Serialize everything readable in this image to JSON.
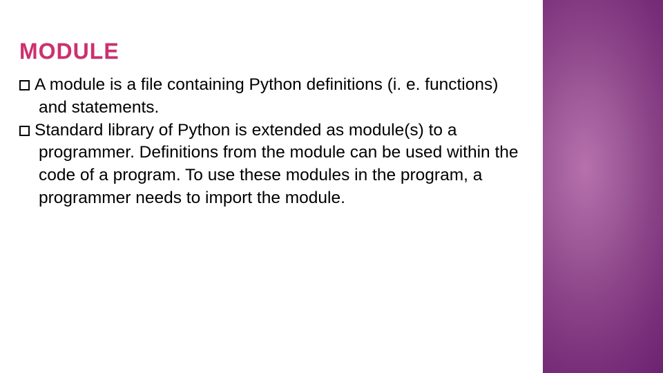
{
  "slide": {
    "title": "MODULE",
    "bullets": [
      "A module is a file containing Python definitions (i. e. functions) and statements.",
      "Standard library of Python is extended as module(s) to a programmer. Definitions from the module can be used within the code of a program. To use these modules in the program, a programmer needs to import the module."
    ]
  },
  "colors": {
    "accent": "#ce2f6f",
    "sidebar_gradient_inner": "#b771ac",
    "sidebar_gradient_outer": "#5b1766"
  }
}
